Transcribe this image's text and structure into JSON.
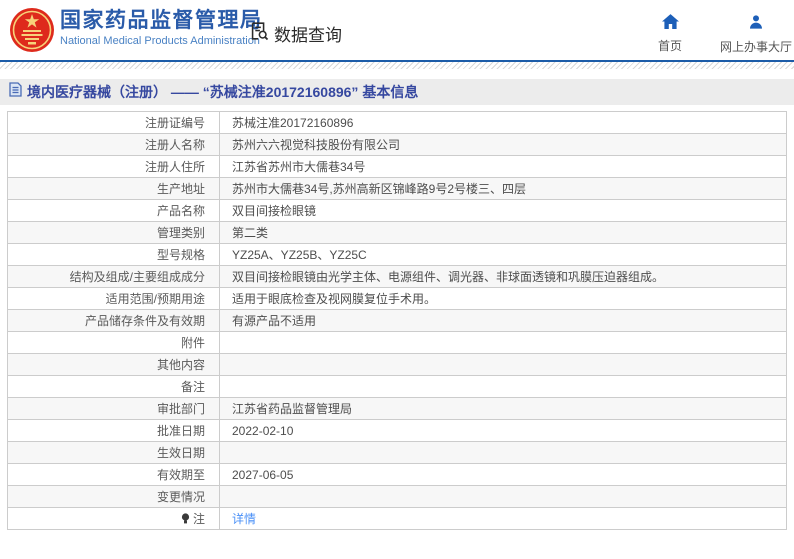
{
  "header": {
    "logo_icon": "national-emblem-icon",
    "title_zh": "国家药品监督管理局",
    "title_en": "National Medical Products Administration",
    "section": {
      "icon": "data-query-icon",
      "label": "数据查询"
    },
    "nav": [
      {
        "icon": "home-icon",
        "label": "首页"
      },
      {
        "icon": "person-icon",
        "label": "网上办事大厅"
      }
    ]
  },
  "breadcrumb": {
    "icon": "document-icon",
    "title": "境内医疗器械（注册） —— “苏械注准20172160896” 基本信息"
  },
  "table": {
    "rows": [
      {
        "label": "注册证编号",
        "value": "苏械注准20172160896"
      },
      {
        "label": "注册人名称",
        "value": "苏州六六视觉科技股份有限公司"
      },
      {
        "label": "注册人住所",
        "value": "江苏省苏州市大儒巷34号"
      },
      {
        "label": "生产地址",
        "value": "苏州市大儒巷34号,苏州高新区锦峰路9号2号楼三、四层"
      },
      {
        "label": "产品名称",
        "value": "双目间接检眼镜"
      },
      {
        "label": "管理类别",
        "value": "第二类"
      },
      {
        "label": "型号规格",
        "value": "YZ25A、YZ25B、YZ25C"
      },
      {
        "label": "结构及组成/主要组成成分",
        "value": "双目间接检眼镜由光学主体、电源组件、调光器、非球面透镜和巩膜压迫器组成。"
      },
      {
        "label": "适用范围/预期用途",
        "value": "适用于眼底检查及视网膜复位手术用。"
      },
      {
        "label": "产品储存条件及有效期",
        "value": "有源产品不适用"
      },
      {
        "label": "附件",
        "value": ""
      },
      {
        "label": "其他内容",
        "value": ""
      },
      {
        "label": "备注",
        "value": ""
      },
      {
        "label": "审批部门",
        "value": "江苏省药品监督管理局"
      },
      {
        "label": "批准日期",
        "value": "2022-02-10"
      },
      {
        "label": "生效日期",
        "value": ""
      },
      {
        "label": "有效期至",
        "value": "2027-06-05"
      },
      {
        "label": "变更情况",
        "value": ""
      },
      {
        "label": "注",
        "label_icon": "bulb-icon",
        "value": "详情",
        "value_type": "link"
      }
    ]
  },
  "colors": {
    "header_blue": "#2a5ba9",
    "header_en_blue": "#4a82c4",
    "separator_blue": "#1c5ca8",
    "breadcrumb_text": "#3648a0",
    "breadcrumb_bg": "#ececec",
    "icon_blue": "#1d5fb8",
    "emblem_red": "#de2a1c",
    "emblem_gold": "#f7d27a",
    "link_blue": "#4a90f7",
    "table_border": "#cccccc",
    "alt_row_bg": "#f7f7f7"
  }
}
